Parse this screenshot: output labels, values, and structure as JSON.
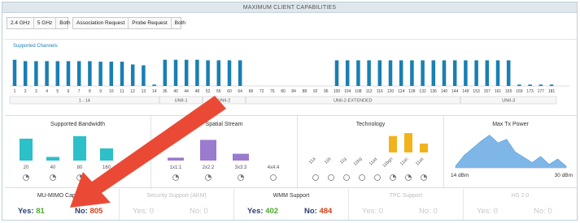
{
  "title": "MAXIMUM CLIENT CAPABILITIES",
  "band_filter": {
    "options": [
      "2.4 GHz",
      "5 GHz",
      "Both"
    ]
  },
  "request_filter": {
    "options": [
      "Association Request",
      "Probe Request",
      "Both"
    ]
  },
  "supported_channels": {
    "label": "Supported Channels",
    "chart_data": {
      "type": "bar",
      "categories": [
        "1",
        "2",
        "3",
        "4",
        "5",
        "6",
        "7",
        "8",
        "9",
        "10",
        "11",
        "12",
        "13",
        "14",
        "36",
        "40",
        "44",
        "48",
        "52",
        "56",
        "60",
        "64",
        "68",
        "72",
        "76",
        "80",
        "84",
        "88",
        "92",
        "96",
        "100",
        "104",
        "108",
        "112",
        "116",
        "120",
        "124",
        "128",
        "132",
        "136",
        "140",
        "144",
        "149",
        "153",
        "157",
        "161",
        "165",
        "169",
        "173",
        "177",
        "181"
      ],
      "values": [
        0.95,
        0.9,
        0.9,
        0.9,
        0.9,
        0.9,
        0.9,
        0.9,
        0.88,
        0.88,
        0.88,
        0.78,
        0.75,
        0.05,
        0.95,
        0.95,
        0.95,
        0.95,
        0.93,
        0.93,
        0.93,
        0.93,
        0,
        0,
        0,
        0,
        0,
        0,
        0,
        0,
        0.93,
        0.93,
        0.93,
        0.93,
        0.93,
        0.93,
        0.93,
        0.93,
        0.93,
        0.93,
        0.93,
        0.93,
        0.93,
        0.93,
        0.93,
        0.93,
        0.93,
        0.05,
        0.05,
        0.05,
        0.05
      ],
      "ylim": [
        0,
        1
      ],
      "groups": [
        {
          "label": "1 - 14",
          "from": 0,
          "to": 13
        },
        {
          "label": "UNII-1",
          "from": 14,
          "to": 17
        },
        {
          "label": "UNII-2",
          "from": 18,
          "to": 21
        },
        {
          "label": "UNII-2-EXTENDED",
          "from": 22,
          "to": 41
        },
        {
          "label": "UNII-3",
          "from": 42,
          "to": 50
        }
      ],
      "color": "#1a7fb2"
    }
  },
  "bandwidth": {
    "title": "Supported Bandwidth",
    "chart_data": {
      "type": "bar",
      "categories": [
        "20",
        "40",
        "80",
        "160"
      ],
      "values": [
        0.9,
        0.15,
        1.0,
        0.5
      ],
      "color": "#2cc0c9"
    }
  },
  "spatial": {
    "title": "Spatial Stream",
    "chart_data": {
      "type": "bar",
      "categories": [
        "1x1:1",
        "2x2:2",
        "3x3:3",
        "4x4:4"
      ],
      "values": [
        0.12,
        0.85,
        0.28,
        0
      ],
      "color": "#9a7bd0"
    }
  },
  "technology": {
    "title": "Technology",
    "chart_data": {
      "type": "bar",
      "categories": [
        "11a",
        "11b",
        "11g",
        "11bg",
        "11ax",
        "11bgn",
        "11ac",
        "11ax"
      ],
      "values": [
        0,
        0,
        0,
        0,
        0,
        0.78,
        0.92,
        0.42
      ],
      "color": "#f2b31a"
    }
  },
  "tx_power": {
    "title": "Max Tx Power",
    "chart_data": {
      "type": "area",
      "x_labels": [
        "14 dBm",
        "30 dBm"
      ],
      "values": [
        0.05,
        0.35,
        0.55,
        0.75,
        0.92,
        0.7,
        0.8,
        0.45,
        0.3,
        0.15,
        0.32,
        0.1,
        0.25,
        0.05
      ],
      "color": "#7fb6e8"
    }
  },
  "capabilities": [
    {
      "title": "MU-MIMO Capable",
      "yes_label": "Yes:",
      "yes": "81",
      "no_label": "No:",
      "no": "805",
      "active": true
    },
    {
      "title": "Security Support (AKM)",
      "yes_label": "Yes:",
      "yes": "0",
      "no_label": "No:",
      "no": "0",
      "active": false
    },
    {
      "title": "WMM Support",
      "yes_label": "Yes:",
      "yes": "402",
      "no_label": "No:",
      "no": "484",
      "active": true
    },
    {
      "title": "TPC Support",
      "yes_label": "Yes:",
      "yes": "0",
      "no_label": "No:",
      "no": "0",
      "active": false
    },
    {
      "title": "HS 2.0",
      "yes_label": "Yes:",
      "yes": "0",
      "no_label": "No:",
      "no": "0",
      "active": false
    }
  ],
  "annotation_color": "#ea4a35"
}
